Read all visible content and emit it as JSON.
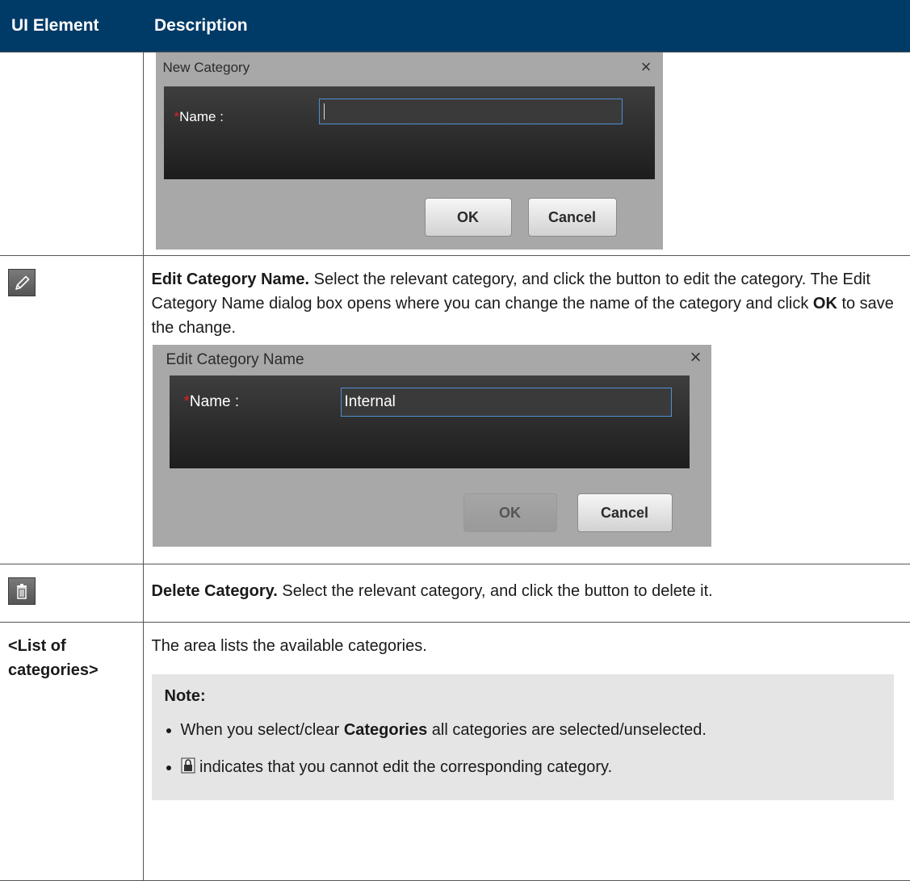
{
  "header": {
    "col1": "UI Element",
    "col2": "Description"
  },
  "row1": {
    "dialog": {
      "title": "New Category",
      "close": "×",
      "required_mark": "*",
      "label": "Name :",
      "ok": "OK",
      "cancel": "Cancel"
    }
  },
  "row2": {
    "icon": "pencil-edit-icon",
    "title": "Edit Category Name.",
    "text1": " Select the relevant category, and click the button to edit the category. The Edit Category Name dialog box opens where you can change the name of the category and click ",
    "ok_word": "OK",
    "text2": " to save the change.",
    "dialog": {
      "title": "Edit Category Name",
      "close": "×",
      "required_mark": "*",
      "label": "Name :",
      "value": "Internal",
      "ok": "OK",
      "cancel": "Cancel"
    }
  },
  "row3": {
    "icon": "trash-icon",
    "title": "Delete Category.",
    "text": " Select the relevant category, and click the button to delete it."
  },
  "row4": {
    "element": "<List of categories>",
    "text": "The area lists the available categories.",
    "note": {
      "title": "Note:",
      "b1_pre": "When you select/clear ",
      "b1_bold": "Categories",
      "b1_post": " all categories are selected/unselected.",
      "b2_icon": "lock-icon",
      "b2_text": " indicates that you cannot edit the corresponding category."
    }
  }
}
